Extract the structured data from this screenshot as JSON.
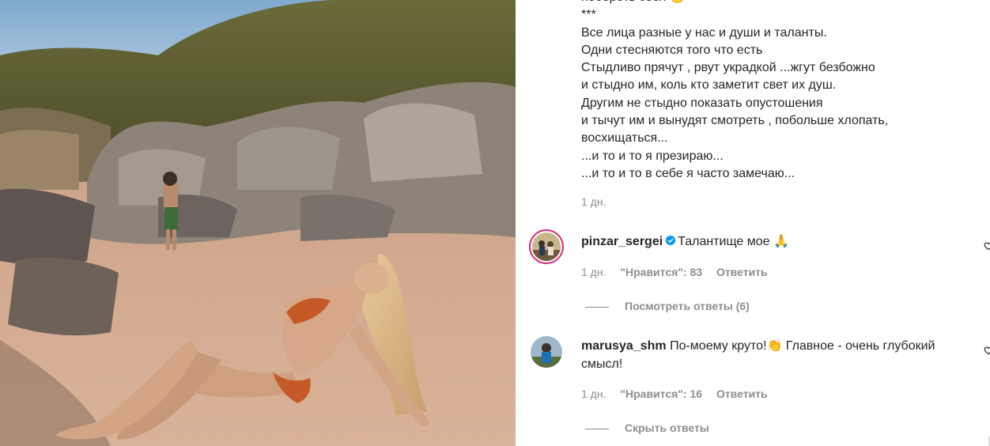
{
  "post": {
    "photo": {
      "description_icon": "beach-photo"
    },
    "caption_lines": [
      "побороть себя 🙂",
      "***",
      "Все лица разные у нас и души и таланты.",
      "Одни стесняются того что есть",
      "Стыдливо прячут , рвут украдкой ...жгут безбожно",
      "и стыдно им, коль кто заметит свет их душ.",
      "Другим не стыдно показать опустошения",
      "и тычут им и вынудят смотреть , побольше хлопать,",
      "восхищаться...",
      "...и то и то я презираю...",
      "...и то и то в себе я часто замечаю..."
    ],
    "caption_time": "1 дн."
  },
  "comments": [
    {
      "username": "pinzar_sergei",
      "verified": true,
      "text": "Талантище мое 🙏",
      "time": "1 дн.",
      "likes": "\"Нравится\": 83",
      "reply": "Ответить",
      "replies_toggle": "Посмотреть ответы (6)"
    },
    {
      "username": "marusya_shm",
      "verified": false,
      "text": "По-моему круто!👏 Главное - очень глубокий смысл!",
      "time": "1 дн.",
      "likes": "\"Нравится\": 16",
      "reply": "Ответить",
      "replies_toggle": "Скрыть ответы"
    }
  ],
  "colors": {
    "text": "#262626",
    "muted": "#8e8e8e",
    "verified": "#0095f6",
    "ring": "#d62976"
  }
}
